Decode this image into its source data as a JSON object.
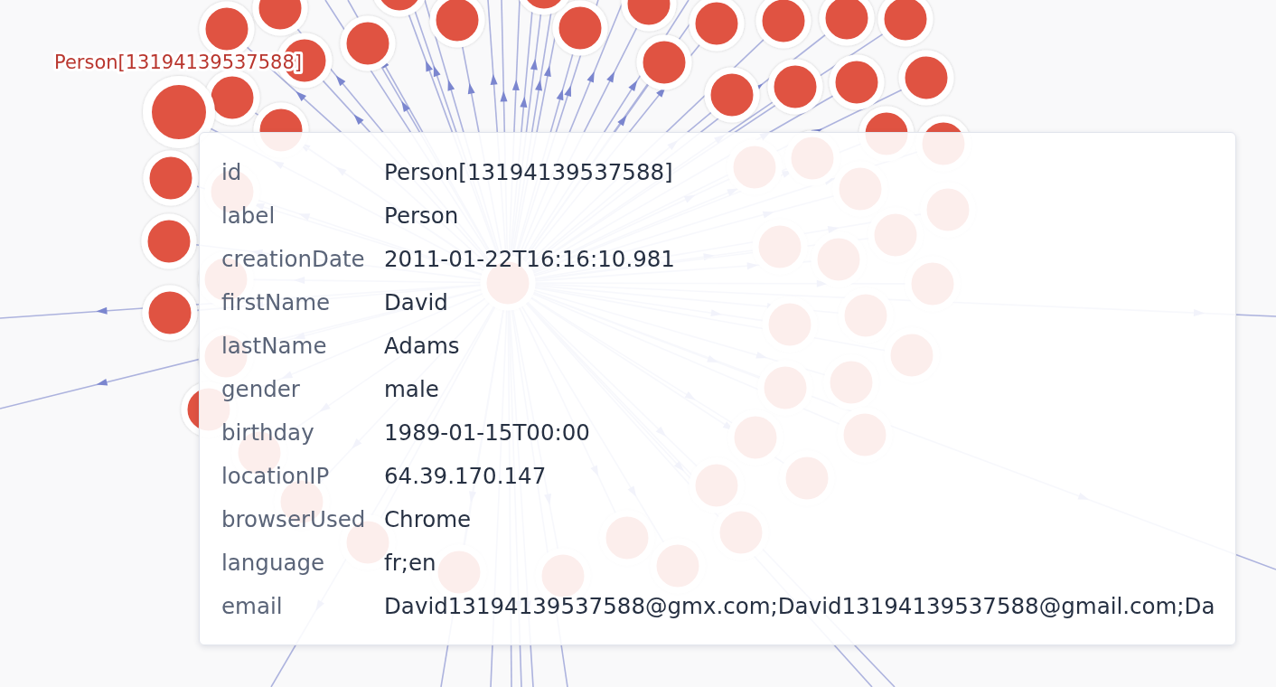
{
  "graph": {
    "focused_node": {
      "label": "Person[13194139537588]",
      "selected": true
    }
  },
  "tooltip": {
    "properties": [
      {
        "key": "id",
        "value": "Person[13194139537588]"
      },
      {
        "key": "label",
        "value": "Person"
      },
      {
        "key": "creationDate",
        "value": "2011-01-22T16:16:10.981"
      },
      {
        "key": "firstName",
        "value": "David"
      },
      {
        "key": "lastName",
        "value": "Adams"
      },
      {
        "key": "gender",
        "value": "male"
      },
      {
        "key": "birthday",
        "value": "1989-01-15T00:00"
      },
      {
        "key": "locationIP",
        "value": "64.39.170.147"
      },
      {
        "key": "browserUsed",
        "value": "Chrome"
      },
      {
        "key": "language",
        "value": "fr;en"
      },
      {
        "key": "email",
        "value": "David13194139537588@gmx.com;David13194139537588@gmail.com;Da"
      }
    ]
  }
}
